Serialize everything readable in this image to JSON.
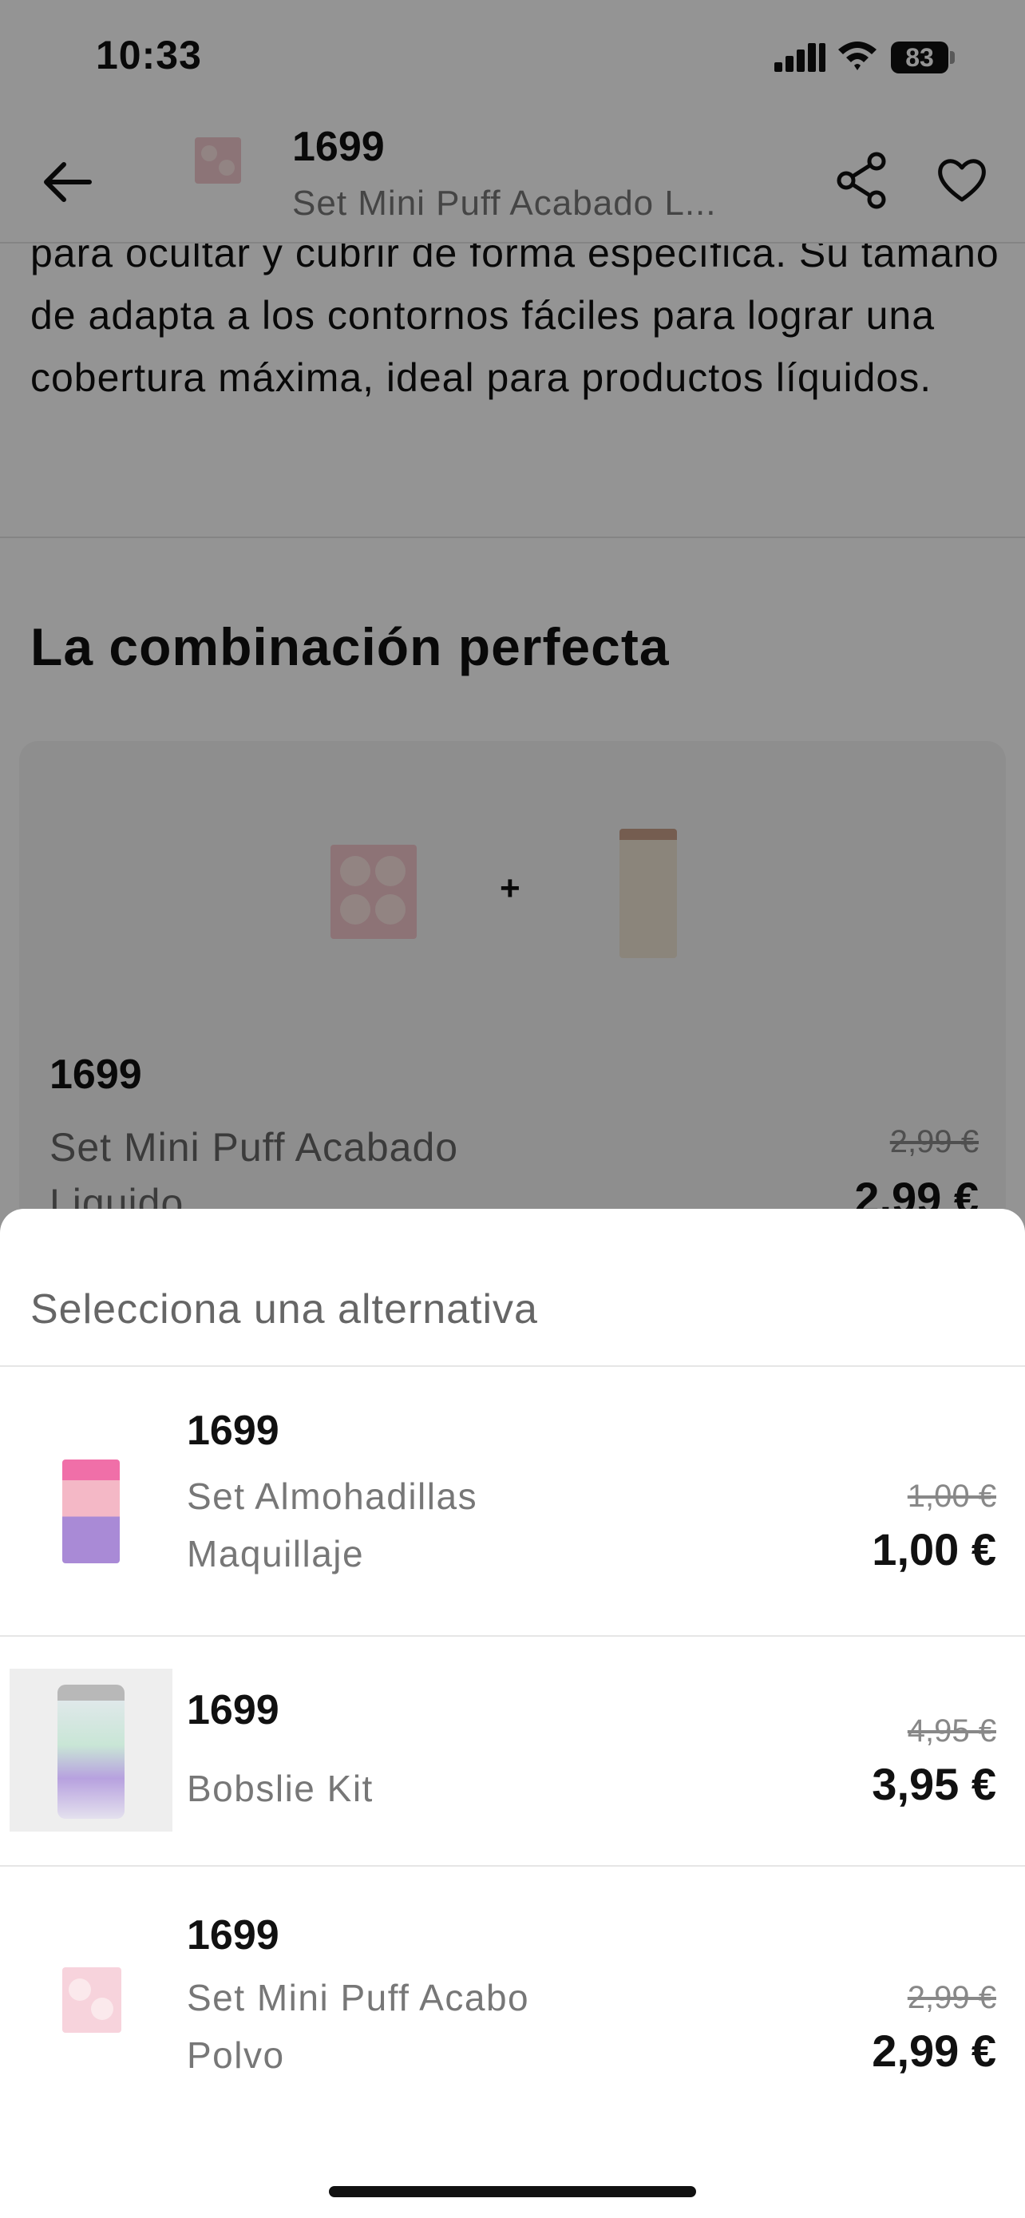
{
  "status_bar": {
    "time": "10:33",
    "battery": "83"
  },
  "header": {
    "code": "1699",
    "subtitle": "Set Mini Puff Acabado L..."
  },
  "description": "para ocultar y cubrir de forma específica. Su tamaño de adapta a los contornos fáciles para lograr una cobertura máxima, ideal para productos líquidos.",
  "combo": {
    "title": "La combinación perfecta",
    "plus": "+",
    "code": "1699",
    "name": "Set Mini Puff Acabado Liquido",
    "old_price": "2,99 €",
    "price": "2,99 €"
  },
  "sheet": {
    "title": "Selecciona una alternativa",
    "options": [
      {
        "code": "1699",
        "name": "Set Almohadillas Maquillaje",
        "old_price": "1,00 €",
        "price": "1,00 €"
      },
      {
        "code": "1699",
        "name": "Bobslie Kit",
        "old_price": "4,95 €",
        "price": "3,95 €"
      },
      {
        "code": "1699",
        "name": "Set Mini Puff Acabo Polvo",
        "old_price": "2,99 €",
        "price": "2,99 €"
      }
    ]
  }
}
